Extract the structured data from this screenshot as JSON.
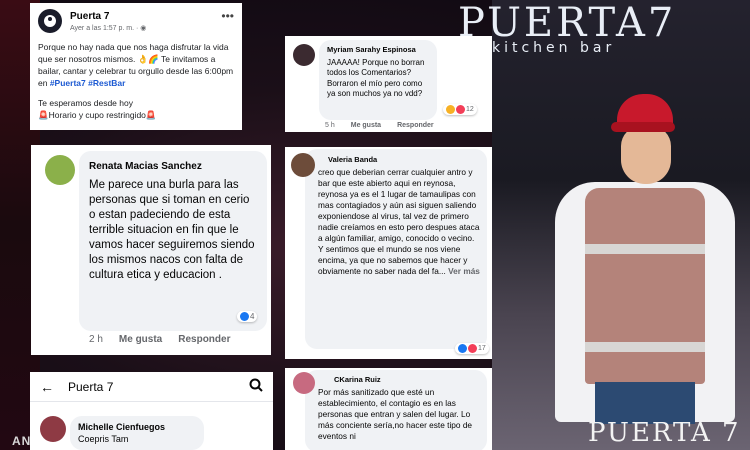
{
  "branding": {
    "top_logo": "PUERTA7",
    "top_sub": "kitchen bar",
    "bottom_logo": "PUERTA 7",
    "left_watermark": "AN"
  },
  "post": {
    "page_name": "Puerta 7",
    "meta": "Ayer a las 1:57 p. m. · ◉",
    "line1": "Porque no hay nada que nos haga disfrutar la vida que ser nosotros mismos. 👌🌈 Te invitamos a bailar, cantar y celebrar tu orgullo desde las 6:00pm en ",
    "hashtag1": "#Puerta7",
    "hashtag2": "#RestBar",
    "line2": "Te esperamos desde hoy",
    "line3": "🚨Horario y cupo restringido🚨"
  },
  "comments": {
    "myriam": {
      "name": "Myriam Sarahy Espinosa",
      "text": "JAAAAA! Porque no borran todos los Comentarios? Borraron el mío pero como ya son muchos ya no vdd?",
      "time": "5 h",
      "like": "Me gusta",
      "reply": "Responder",
      "reactions": "12"
    },
    "renata": {
      "name": "Renata Macias Sanchez",
      "text": "Me parece una burla para las personas que si toman en cerio o estan padeciendo de esta terrible situacion en fin que le vamos hacer seguiremos siendo los mismos nacos con falta de cultura etica y educacion .",
      "time": "2 h",
      "like": "Me gusta",
      "reply": "Responder",
      "reactions": "4"
    },
    "valeria": {
      "name": "Valeria Banda",
      "text": "creo que deberian cerrar cualquier antro y bar que este abierto aqui en reynosa, reynosa ya es el 1 lugar de tamaulipas con mas contagiados y aún asi siguen saliendo exponiendose al virus, tal vez de primero nadie creíamos en esto pero despues ataca a algún familiar, amigo, conocido o vecino. Y sentimos que el mundo se nos viene encima, ya que no sabemos que hacer y obviamente no saber nada del fa...",
      "more": "Ver más",
      "reactions": "17"
    },
    "karina": {
      "name": "CKarina Ruiz",
      "text": "Por más sanitizado que esté un establecimiento, el contagio es en las personas que entran y salen del lugar. Lo más conciente sería,no hacer este tipo de eventos ni"
    }
  },
  "mobile": {
    "title": "Puerta 7",
    "commenter": "Michelle Cienfuegos",
    "text": "Coepris Tam"
  },
  "colors": {
    "hashtag": "#1d5ad2",
    "cap_red": "#c8192c",
    "like_blue": "#1877f2"
  }
}
